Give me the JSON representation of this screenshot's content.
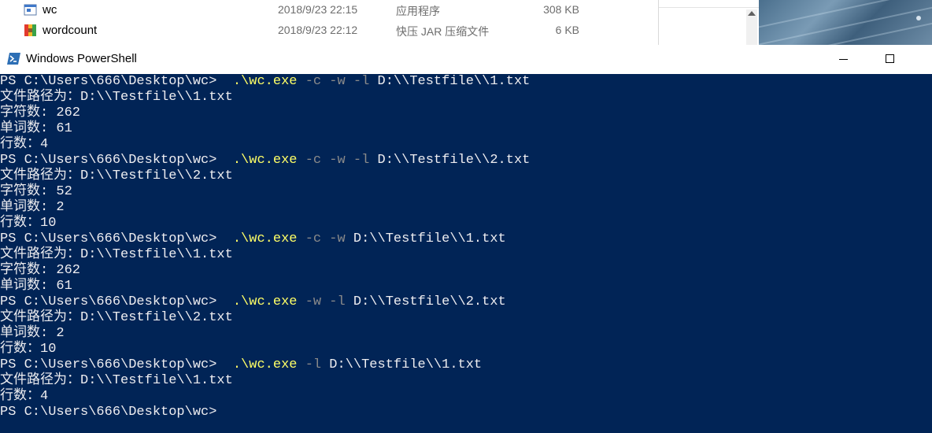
{
  "explorer": {
    "files": [
      {
        "name": "wc",
        "date": "2018/9/23 22:15",
        "type": "应用程序",
        "size": "308 KB",
        "icon": "exe-icon"
      },
      {
        "name": "wordcount",
        "date": "2018/9/23 22:12",
        "type": "快压 JAR 压缩文件",
        "size": "6 KB",
        "icon": "jar-archive-icon"
      }
    ]
  },
  "window": {
    "title": "Windows PowerShell",
    "icon": "powershell-icon",
    "minimize_icon": "minimize-icon",
    "maximize_icon": "maximize-icon"
  },
  "colors": {
    "console_bg": "#012456",
    "console_text": "#eeedf0",
    "command": "#ffff66",
    "parameter": "#8a8a8a"
  },
  "console": {
    "lines": [
      {
        "kind": "cmd",
        "prompt": "PS C:\\Users\\666\\Desktop\\wc>",
        "command": ".\\wc.exe",
        "params": [
          "-c",
          "-w",
          "-l"
        ],
        "argument": "D:\\\\Testfile\\\\1.txt"
      },
      {
        "kind": "out",
        "text": "文件路径为：D:\\\\Testfile\\\\1.txt"
      },
      {
        "kind": "out",
        "text": "字符数: 262"
      },
      {
        "kind": "out",
        "text": "单词数: 61"
      },
      {
        "kind": "out",
        "text": "行数：4"
      },
      {
        "kind": "cmd",
        "prompt": "PS C:\\Users\\666\\Desktop\\wc>",
        "command": ".\\wc.exe",
        "params": [
          "-c",
          "-w",
          "-l"
        ],
        "argument": "D:\\\\Testfile\\\\2.txt"
      },
      {
        "kind": "out",
        "text": "文件路径为：D:\\\\Testfile\\\\2.txt"
      },
      {
        "kind": "out",
        "text": "字符数: 52"
      },
      {
        "kind": "out",
        "text": "单词数: 2"
      },
      {
        "kind": "out",
        "text": "行数：10"
      },
      {
        "kind": "cmd",
        "prompt": "PS C:\\Users\\666\\Desktop\\wc>",
        "command": ".\\wc.exe",
        "params": [
          "-c",
          "-w"
        ],
        "argument": "D:\\\\Testfile\\\\1.txt"
      },
      {
        "kind": "out",
        "text": "文件路径为：D:\\\\Testfile\\\\1.txt"
      },
      {
        "kind": "out",
        "text": "字符数: 262"
      },
      {
        "kind": "out",
        "text": "单词数: 61"
      },
      {
        "kind": "cmd",
        "prompt": "PS C:\\Users\\666\\Desktop\\wc>",
        "command": ".\\wc.exe",
        "params": [
          "-w",
          "-l"
        ],
        "argument": "D:\\\\Testfile\\\\2.txt"
      },
      {
        "kind": "out",
        "text": "文件路径为：D:\\\\Testfile\\\\2.txt"
      },
      {
        "kind": "out",
        "text": "单词数: 2"
      },
      {
        "kind": "out",
        "text": "行数：10"
      },
      {
        "kind": "cmd",
        "prompt": "PS C:\\Users\\666\\Desktop\\wc>",
        "command": ".\\wc.exe",
        "params": [
          "-l"
        ],
        "argument": "D:\\\\Testfile\\\\1.txt"
      },
      {
        "kind": "out",
        "text": "文件路径为：D:\\\\Testfile\\\\1.txt"
      },
      {
        "kind": "out",
        "text": "行数：4"
      },
      {
        "kind": "cmd",
        "prompt": "PS C:\\Users\\666\\Desktop\\wc>",
        "command": "",
        "params": [],
        "argument": ""
      }
    ]
  }
}
